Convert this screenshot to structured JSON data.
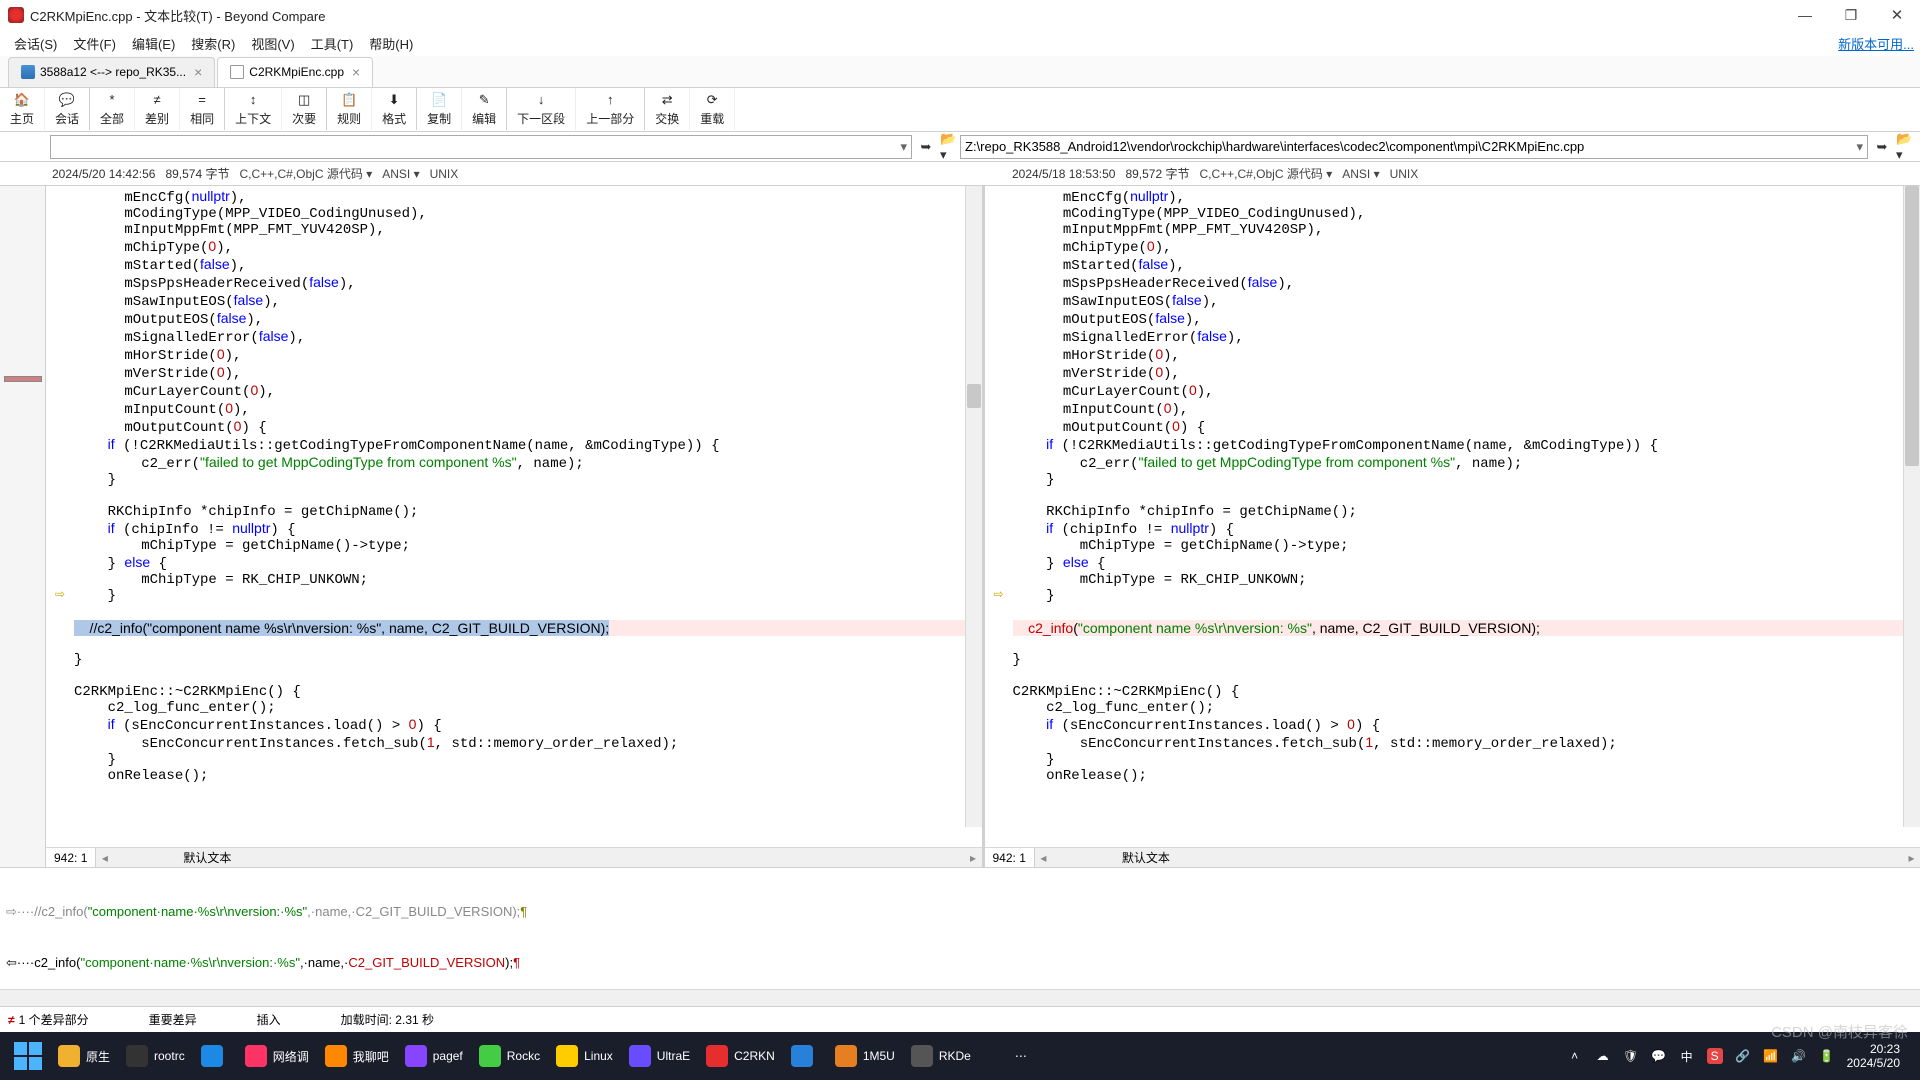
{
  "app": {
    "title": "C2RKMpiEnc.cpp - 文本比较(T) - Beyond Compare",
    "update_notice": "新版本可用..."
  },
  "window_controls": {
    "min": "—",
    "max": "❐",
    "close": "✕"
  },
  "menu": [
    "会话(S)",
    "文件(F)",
    "编辑(E)",
    "搜索(R)",
    "视图(V)",
    "工具(T)",
    "帮助(H)"
  ],
  "tabs": [
    {
      "label": "3588a12 <--> repo_RK35...",
      "icon": "doc",
      "active": false
    },
    {
      "label": "C2RKMpiEnc.cpp",
      "icon": "file",
      "active": true
    }
  ],
  "toolbar": [
    {
      "label": "主页",
      "icon": "🏠"
    },
    {
      "label": "会话",
      "icon": "💬"
    },
    {
      "label": "全部",
      "icon": "*"
    },
    {
      "label": "差别",
      "icon": "≠"
    },
    {
      "label": "相同",
      "icon": "="
    },
    {
      "label": "上下文",
      "icon": "↕"
    },
    {
      "label": "次要",
      "icon": "◫"
    },
    {
      "label": "规则",
      "icon": "📋"
    },
    {
      "label": "格式",
      "icon": "⬇"
    },
    {
      "label": "复制",
      "icon": "📄"
    },
    {
      "label": "编辑",
      "icon": "✎"
    },
    {
      "label": "下一区段",
      "icon": "↓"
    },
    {
      "label": "上一部分",
      "icon": "↑"
    },
    {
      "label": "交换",
      "icon": "⇄"
    },
    {
      "label": "重载",
      "icon": "⟳"
    }
  ],
  "paths": {
    "left": "",
    "right": "Z:\\repo_RK3588_Android12\\vendor\\rockchip\\hardware\\interfaces\\codec2\\component\\mpi\\C2RKMpiEnc.cpp"
  },
  "meta": {
    "left": {
      "datetime": "2024/5/20 14:42:56",
      "size": "89,574 字节",
      "lang": "C,C++,C#,ObjC 源代码",
      "enc": "ANSI",
      "eol": "UNIX"
    },
    "right": {
      "datetime": "2024/5/18 18:53:50",
      "size": "89,572 字节",
      "lang": "C,C++,C#,ObjC 源代码",
      "enc": "ANSI",
      "eol": "UNIX"
    }
  },
  "position": {
    "left": "942: 1",
    "right": "942: 1",
    "label_left": "默认文本",
    "label_right": "默认文本"
  },
  "diff_left": "    //c2_info(\"component name %s\\r\\nversion: %s\", name, C2_GIT_BUILD_VERSION);",
  "diff_right": "    c2_info(\"component name %s\\r\\nversion: %s\", name, C2_GIT_BUILD_VERSION);",
  "diffmerge": {
    "line1_pre": "⇨····//c2_info(",
    "line1_str": "\"component·name·%s\\r\\nversion:·%s\"",
    "line1_post": ",·name,·C2_GIT_BUILD_VERSION);",
    "line2_pre": "⇦····c2_info(",
    "line2_str": "\"component·name·%s\\r\\nversion:·%s\"",
    "line2_post": ",·name,·",
    "line2_sym": "C2_GIT_BUILD_VERSION",
    "line2_end": ");"
  },
  "status": {
    "diff_count": "1 个差异部分",
    "important": "重要差异",
    "mode": "插入",
    "load": "加载时间: 2.31 秒"
  },
  "taskbar": {
    "apps": [
      {
        "label": "原生",
        "color": "#f0b030"
      },
      {
        "label": "rootrc",
        "color": "#333"
      },
      {
        "label": "",
        "color": "#1e88e5"
      },
      {
        "label": "网络调",
        "color": "#ff3366"
      },
      {
        "label": "我聊吧",
        "color": "#ff8800"
      },
      {
        "label": "pagef",
        "color": "#8844ff"
      },
      {
        "label": "Rockc",
        "color": "#44cc44"
      },
      {
        "label": "Linux",
        "color": "#ffcc00"
      },
      {
        "label": "UltraE",
        "color": "#6a4cff"
      },
      {
        "label": "C2RKN",
        "color": "#e62e2e"
      },
      {
        "label": "",
        "color": "#2980d9"
      },
      {
        "label": "1M5U",
        "color": "#e67e22"
      },
      {
        "label": "RKDe",
        "color": "#555"
      },
      {
        "label": "⋯",
        "color": "transparent"
      }
    ],
    "clock": {
      "time": "20:23",
      "date": "2024/5/20"
    }
  },
  "watermark": "CSDN @南枝异客徐"
}
